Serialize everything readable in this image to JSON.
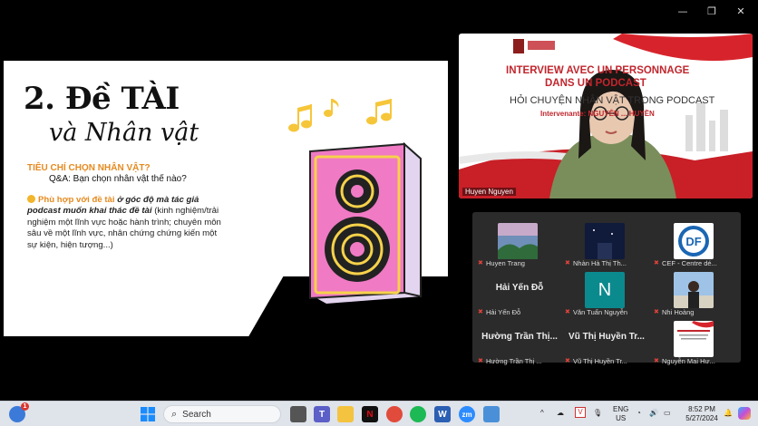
{
  "window": {
    "controls": [
      "—",
      "❐",
      "✕"
    ]
  },
  "slide": {
    "title_line1": "2. Đề TÀI",
    "title_line2": "và Nhân vật",
    "criteria": "TIÊU CHÍ CHỌN NHÂN VẬT?",
    "qa": "Q&A: Bạn chọn nhân vật thế nào?",
    "body_highlight": "Phù hợp với đề tài",
    "body_bold_italic": "ở góc độ mà tác giả podcast muốn khai thác đề tài",
    "body_rest": "(kinh nghiệm/trải nghiệm một lĩnh vực hoặc hành trình; chuyên môn sâu về một lĩnh vực, nhân chứng chứng kiến một sự kiện, hiện tượng...)",
    "colors": {
      "accent": "#e58a1f",
      "speaker_pink": "#f07ac4",
      "speaker_yellow": "#f6d24a",
      "speaker_side": "#e3d4ef"
    }
  },
  "main_video": {
    "title1": "INTERVIEW AVEC UN PERSONNAGE",
    "title2": "DANS UN PODCAST",
    "subtitle": "HỎI CHUYỆN NHÂN VẬT TRONG PODCAST",
    "intervenant": "Intervenante: NGUYỄN ... HUYỀN",
    "name": "Huyen Nguyen"
  },
  "participants": [
    {
      "name": "Huyen Trang",
      "thumb": "landscape"
    },
    {
      "name": "Nhàn Hà Thị Th...",
      "thumb": "night"
    },
    {
      "name": "CEF - Centre dé...",
      "thumb": "logo",
      "logo_text": "DF"
    },
    {
      "name": "Hải Yến Đỗ",
      "big": "Hải Yến Đỗ"
    },
    {
      "name": "Văn Tuấn Nguyễn",
      "thumb": "letter",
      "letter": "N"
    },
    {
      "name": "Nhi Hoàng",
      "thumb": "photo"
    },
    {
      "name": "Hường Trần Thị ...",
      "big": "Hường Trần Thị..."
    },
    {
      "name": "Vũ Thị Huyền Tr...",
      "big": "Vũ Thị Huyền Tr..."
    },
    {
      "name": "Nguyễn Mai Hư...",
      "thumb": "slide"
    }
  ],
  "taskbar": {
    "search_placeholder": "Search",
    "notification_badge": "1",
    "lang": "ENG",
    "region": "US",
    "time": "8:52 PM",
    "date": "5/27/2024"
  }
}
